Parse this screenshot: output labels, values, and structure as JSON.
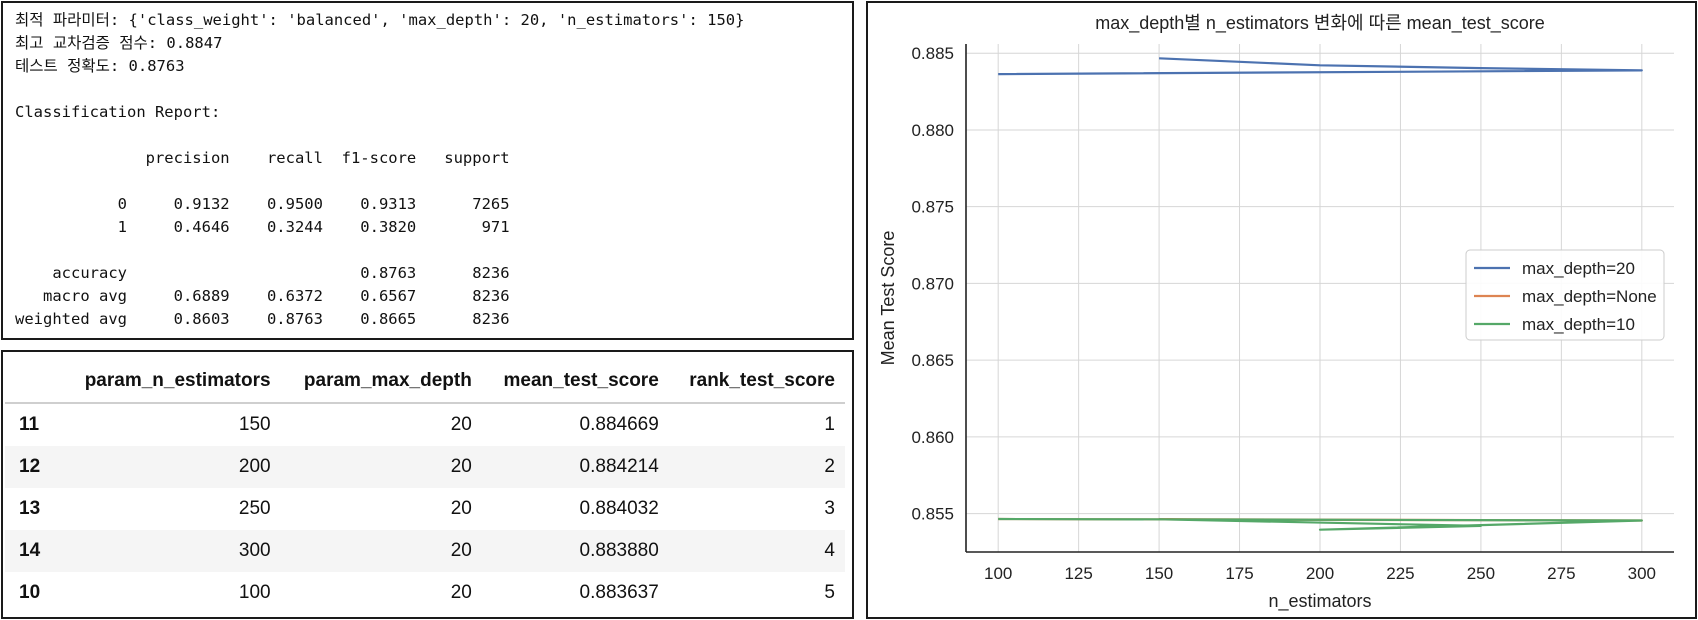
{
  "console": {
    "lines": [
      "최적 파라미터: {'class_weight': 'balanced', 'max_depth': 20, 'n_estimators': 150}",
      "최고 교차검증 점수: 0.8847",
      "테스트 정확도: 0.8763",
      "",
      "Classification Report:",
      "",
      "              precision    recall  f1-score   support",
      "",
      "           0     0.9132    0.9500    0.9313      7265",
      "           1     0.4646    0.3244    0.3820       971",
      "",
      "    accuracy                         0.8763      8236",
      "   macro avg     0.6889    0.6372    0.6567      8236",
      "weighted avg     0.8603    0.8763    0.8665      8236"
    ]
  },
  "results_table": {
    "columns": [
      "",
      "param_n_estimators",
      "param_max_depth",
      "mean_test_score",
      "rank_test_score"
    ],
    "rows": [
      [
        "11",
        "150",
        "20",
        "0.884669",
        "1"
      ],
      [
        "12",
        "200",
        "20",
        "0.884214",
        "2"
      ],
      [
        "13",
        "250",
        "20",
        "0.884032",
        "3"
      ],
      [
        "14",
        "300",
        "20",
        "0.883880",
        "4"
      ],
      [
        "10",
        "100",
        "20",
        "0.883637",
        "5"
      ]
    ]
  },
  "chart_data": {
    "type": "line",
    "title": "max_depth별 n_estimators 변화에 따른 mean_test_score",
    "xlabel": "n_estimators",
    "ylabel": "Mean Test Score",
    "xlim": [
      90,
      310
    ],
    "ylim": [
      0.8525,
      0.8856
    ],
    "xticks": [
      100,
      125,
      150,
      175,
      200,
      225,
      250,
      275,
      300
    ],
    "yticks": [
      0.855,
      0.86,
      0.865,
      0.87,
      0.875,
      0.88,
      0.885
    ],
    "ytick_labels": [
      "0.855",
      "0.860",
      "0.865",
      "0.870",
      "0.875",
      "0.880",
      "0.885"
    ],
    "grid": true,
    "legend_position": "center-right",
    "series": [
      {
        "name": "max_depth=20",
        "color": "#4c72b0",
        "x": [
          150,
          200,
          250,
          300,
          100
        ],
        "y": [
          0.884669,
          0.884214,
          0.884032,
          0.88388,
          0.883637
        ]
      },
      {
        "name": "max_depth=None",
        "color": "#dd8452",
        "x": [
          100,
          300,
          150,
          200,
          250
        ],
        "y": [
          0.85465,
          0.85455,
          0.85464,
          0.85459,
          0.85457
        ]
      },
      {
        "name": "max_depth=10",
        "color": "#55a868",
        "x": [
          100,
          300,
          200,
          250,
          150
        ],
        "y": [
          0.85465,
          0.85455,
          0.85395,
          0.8542,
          0.85463
        ]
      }
    ]
  }
}
